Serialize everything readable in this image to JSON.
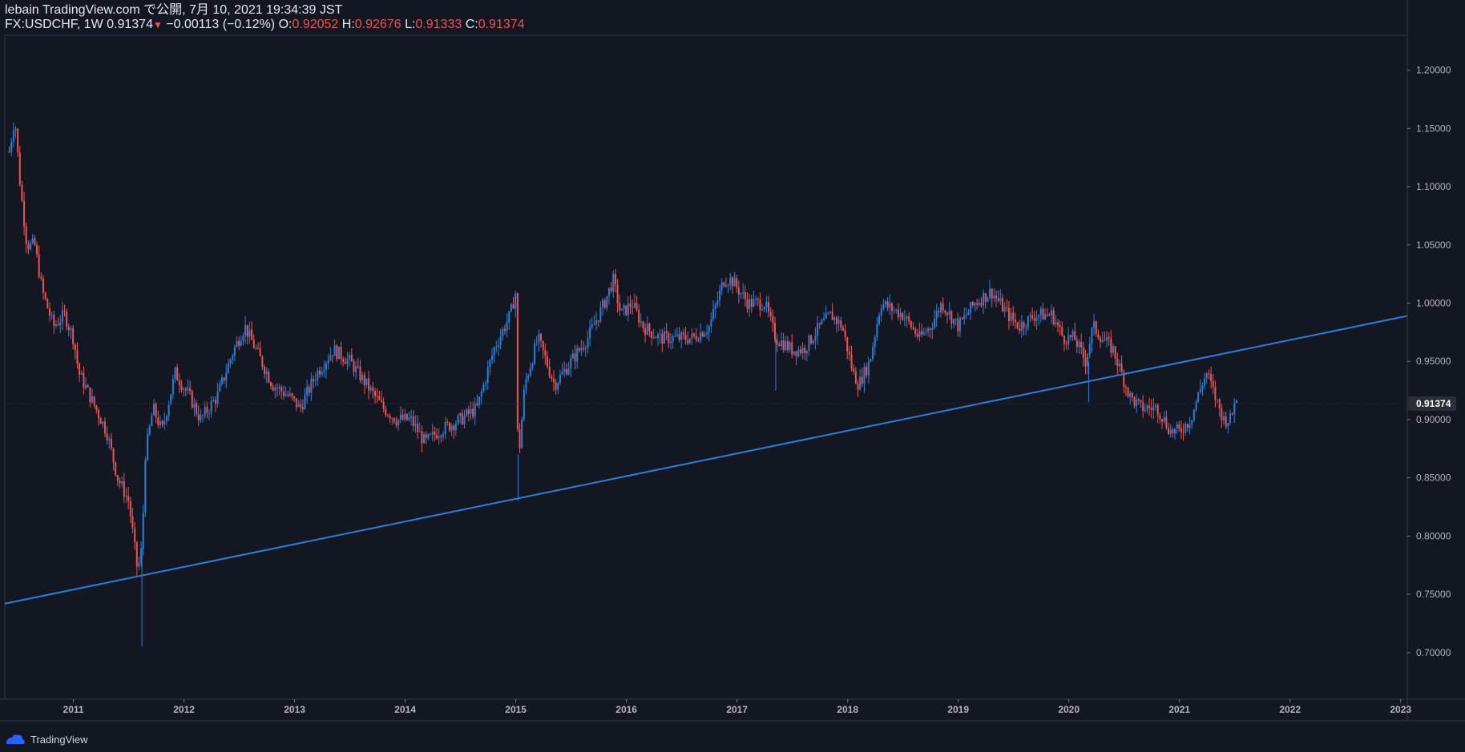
{
  "header": {
    "published_line": "lebain TradingView.com で公開, 7月 10, 2021 19:34:39 JST",
    "symbol": "FX:USDCHF, 1W",
    "last": "0.91374",
    "change": "−0.00113 (−0.12%)",
    "open_label": "O:",
    "open": "0.92052",
    "high_label": "H:",
    "high": "0.92676",
    "low_label": "L:",
    "low": "0.91333",
    "close_label": "C:",
    "close": "0.91374"
  },
  "footer": {
    "brand": "TradingView"
  },
  "colors": {
    "background": "#131722",
    "up": "#2a7fdb",
    "down": "#ef5350",
    "trendline": "#2a7fdb",
    "axis": "#b2b5be"
  },
  "chart_data": {
    "type": "candlestick",
    "title": "",
    "xlabel": "",
    "ylabel": "",
    "x_ticks": [
      "2011",
      "2012",
      "2013",
      "2014",
      "2015",
      "2016",
      "2017",
      "2018",
      "2019",
      "2020",
      "2021",
      "2022",
      "2023"
    ],
    "y_ticks": [
      "0.70000",
      "0.75000",
      "0.80000",
      "0.85000",
      "0.90000",
      "0.95000",
      "1.00000",
      "1.05000",
      "1.10000",
      "1.15000",
      "1.20000"
    ],
    "xlim": [
      2010.38,
      2023.06
    ],
    "ylim": [
      0.66,
      1.23
    ],
    "last_price": 0.91374,
    "last_price_label": "0.91374",
    "price_path": [
      [
        2010.42,
        1.13
      ],
      [
        2010.47,
        1.16
      ],
      [
        2010.52,
        1.1
      ],
      [
        2010.58,
        1.05
      ],
      [
        2010.65,
        1.05
      ],
      [
        2010.72,
        1.01
      ],
      [
        2010.82,
        0.98
      ],
      [
        2010.92,
        0.99
      ],
      [
        2011.0,
        0.97
      ],
      [
        2011.05,
        0.94
      ],
      [
        2011.15,
        0.92
      ],
      [
        2011.3,
        0.89
      ],
      [
        2011.4,
        0.85
      ],
      [
        2011.5,
        0.83
      ],
      [
        2011.58,
        0.77
      ],
      [
        2011.62,
        0.79
      ],
      [
        2011.65,
        0.87
      ],
      [
        2011.72,
        0.91
      ],
      [
        2011.8,
        0.89
      ],
      [
        2011.92,
        0.94
      ],
      [
        2012.05,
        0.92
      ],
      [
        2012.15,
        0.9
      ],
      [
        2012.3,
        0.92
      ],
      [
        2012.45,
        0.96
      ],
      [
        2012.55,
        0.98
      ],
      [
        2012.65,
        0.96
      ],
      [
        2012.8,
        0.93
      ],
      [
        2012.95,
        0.92
      ],
      [
        2013.05,
        0.91
      ],
      [
        2013.2,
        0.94
      ],
      [
        2013.35,
        0.96
      ],
      [
        2013.5,
        0.95
      ],
      [
        2013.65,
        0.93
      ],
      [
        2013.8,
        0.91
      ],
      [
        2013.92,
        0.9
      ],
      [
        2014.05,
        0.9
      ],
      [
        2014.18,
        0.88
      ],
      [
        2014.3,
        0.89
      ],
      [
        2014.5,
        0.9
      ],
      [
        2014.65,
        0.91
      ],
      [
        2014.8,
        0.96
      ],
      [
        2014.95,
        0.99
      ],
      [
        2015.0,
        1.01
      ],
      [
        2015.02,
        0.86
      ],
      [
        2015.08,
        0.93
      ],
      [
        2015.2,
        0.97
      ],
      [
        2015.35,
        0.93
      ],
      [
        2015.5,
        0.95
      ],
      [
        2015.65,
        0.97
      ],
      [
        2015.8,
        1.0
      ],
      [
        2015.88,
        1.02
      ],
      [
        2015.95,
        0.99
      ],
      [
        2016.05,
        1.0
      ],
      [
        2016.15,
        0.98
      ],
      [
        2016.3,
        0.97
      ],
      [
        2016.45,
        0.97
      ],
      [
        2016.6,
        0.97
      ],
      [
        2016.75,
        0.98
      ],
      [
        2016.88,
        1.02
      ],
      [
        2016.95,
        1.02
      ],
      [
        2017.1,
        1.0
      ],
      [
        2017.25,
        1.0
      ],
      [
        2017.35,
        0.97
      ],
      [
        2017.5,
        0.96
      ],
      [
        2017.6,
        0.96
      ],
      [
        2017.75,
        0.98
      ],
      [
        2017.85,
        0.99
      ],
      [
        2017.95,
        0.98
      ],
      [
        2018.05,
        0.94
      ],
      [
        2018.1,
        0.93
      ],
      [
        2018.2,
        0.95
      ],
      [
        2018.3,
        1.0
      ],
      [
        2018.5,
        0.99
      ],
      [
        2018.65,
        0.97
      ],
      [
        2018.75,
        0.98
      ],
      [
        2018.85,
        1.0
      ],
      [
        2019.0,
        0.98
      ],
      [
        2019.15,
        1.0
      ],
      [
        2019.3,
        1.01
      ],
      [
        2019.45,
        0.99
      ],
      [
        2019.55,
        0.98
      ],
      [
        2019.7,
        0.99
      ],
      [
        2019.85,
        0.99
      ],
      [
        2019.95,
        0.97
      ],
      [
        2020.05,
        0.97
      ],
      [
        2020.15,
        0.95
      ],
      [
        2020.22,
        0.98
      ],
      [
        2020.3,
        0.97
      ],
      [
        2020.4,
        0.96
      ],
      [
        2020.55,
        0.92
      ],
      [
        2020.65,
        0.91
      ],
      [
        2020.8,
        0.91
      ],
      [
        2020.92,
        0.89
      ],
      [
        2021.0,
        0.89
      ],
      [
        2021.1,
        0.9
      ],
      [
        2021.2,
        0.93
      ],
      [
        2021.25,
        0.94
      ],
      [
        2021.32,
        0.92
      ],
      [
        2021.4,
        0.9
      ],
      [
        2021.47,
        0.9
      ],
      [
        2021.5,
        0.92
      ],
      [
        2021.52,
        0.914
      ]
    ],
    "trendline": {
      "x": [
        2010.38,
        2023.06
      ],
      "y": [
        0.742,
        0.989
      ]
    }
  }
}
